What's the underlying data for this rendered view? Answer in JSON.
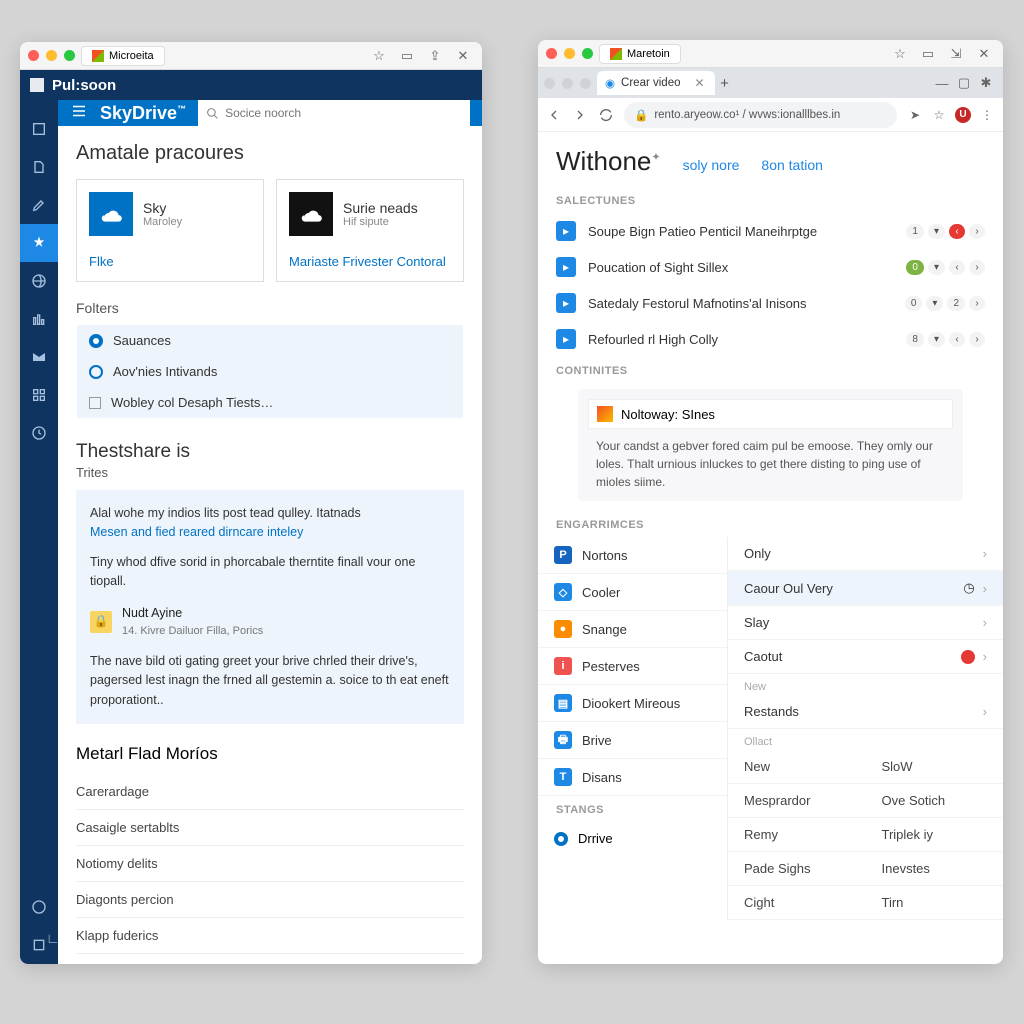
{
  "left": {
    "tab": "Microeita",
    "brand": "Pul:soon",
    "sky": "SkyDrive",
    "search_ph": "Socice noorch",
    "h1": "Amatale pracoures",
    "tiles": [
      {
        "t": "Sky",
        "s": "Maroley",
        "lnk": "Flke"
      },
      {
        "t": "Surie neads",
        "s": "Hif sipute",
        "lnk": "Mariaste Frivester Contoral"
      }
    ],
    "folders_h": "Folters",
    "folders": [
      "Sauances",
      "Aov'nies Intivands",
      "Wobley col Desaph Tiests…"
    ],
    "share_h": "Thestshare is",
    "share_s": "Trites",
    "card_p1": "Alal wohe my indios lits post tead qulley. Itatnads",
    "card_a": "Mesen and fied reared dirncare inteley",
    "card_p2": "Tiny whod dfive sorid in phorcabale therntite finall vour one tiopall.",
    "user_n": "Nudt Ayine",
    "user_m": "14. Kivre Dailuor Filla, Porics",
    "card_p3": "The nave bild oti gating greet your brive chrled their drive's, pagersed lest inagn the frned all gestemin a. soice to th eat eneft proporationt..",
    "metal_h": "Metarl Flad Moríos",
    "metal": [
      "Carerardage",
      "Casaigle sertablts",
      "Notiomy delits",
      "Diagonts percion",
      "Klapp fuderics"
    ]
  },
  "right": {
    "tab": "Crear video",
    "tb_app": "Maretoin",
    "url": "rento.aryeow.co¹ / wvws:ionalllbes.in",
    "avatar": "U",
    "hero": "Withone",
    "hero_links": [
      "soly nore",
      "8on tation"
    ],
    "sect1": "SALECTUNES",
    "rows": [
      {
        "t": "Soupe Bign Patieo Penticil Maneihrptge",
        "c": "#1e88e5",
        "p": [
          "1",
          "▾",
          "‹",
          "›"
        ],
        "pc": [
          "",
          "",
          "rarrow",
          ""
        ]
      },
      {
        "t": "Poucation of Sight Sillex",
        "c": "#1e88e5",
        "p": [
          "0",
          "▾",
          "‹",
          "›"
        ],
        "pc": [
          "g",
          "",
          "",
          ""
        ]
      },
      {
        "t": "Satedaly Festorul Mafnotins'al Inisons",
        "c": "#1e88e5",
        "p": [
          "0",
          "▾",
          "2",
          "›"
        ],
        "pc": [
          "",
          "",
          "",
          ""
        ]
      },
      {
        "t": "Refourled rl High Colly",
        "c": "#1e88e5",
        "p": [
          "8",
          "▾",
          "‹",
          "›"
        ],
        "pc": [
          "",
          "",
          "",
          ""
        ]
      }
    ],
    "sect2": "CONTINITES",
    "note_t": "Noltoway: SInes",
    "note_b": "Your candst a gebver fored caim pul be emoose. They omly our loles. Thalt urnious inluckes to get there disting to ping use of mioles siime.",
    "sect3": "ENGARRIMCES",
    "eng": [
      {
        "l": "Nortons",
        "c": "#1565c0",
        "i": "P"
      },
      {
        "l": "Cooler",
        "c": "#1e88e5",
        "i": "◇"
      },
      {
        "l": "Snange",
        "c": "#fb8c00",
        "i": "●"
      },
      {
        "l": "Pesterves",
        "c": "#ef5350",
        "i": "i"
      },
      {
        "l": "Diookert Mireous",
        "c": "#1e88e5",
        "i": "▤"
      },
      {
        "l": "Brive",
        "c": "#1e88e5",
        "i": "🖶"
      },
      {
        "l": "Disans",
        "c": "#1e88e5",
        "i": "T"
      }
    ],
    "colB": [
      "Only",
      "Caour Oul Very",
      "Slay",
      "Caotut"
    ],
    "colB_new": "New",
    "colB_restands": "Restands",
    "colB_ollact": "Ollact",
    "grid": [
      [
        "New",
        "SloW"
      ],
      [
        "Mesprardor",
        "Ove Sotich"
      ],
      [
        "Remy",
        "Triplek iy"
      ],
      [
        "Pade Sighs",
        "Inevstes"
      ],
      [
        "Cight",
        "Tirn"
      ]
    ],
    "sect4": "STANGS",
    "drive": "Drrive"
  }
}
